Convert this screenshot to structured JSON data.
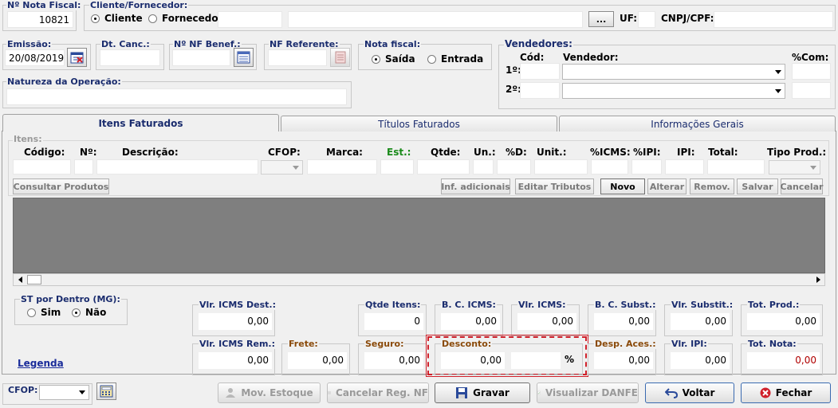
{
  "header": {
    "nota_fiscal_label": "Nº Nota Fiscal:",
    "nota_fiscal_value": "10821",
    "cliente_fornecedor_label": "Cliente/Fornecedor:",
    "radio_cliente": "Cliente",
    "radio_fornecedor": "Fornecedor",
    "ellipsis_label": "...",
    "uf_label": "UF:",
    "cnpj_label": "CNPJ/CPF:"
  },
  "dates": {
    "emissao_label": "Emissão:",
    "emissao_value": "20/08/2019",
    "dt_canc_label": "Dt. Canc.:",
    "nf_benef_label": "Nº NF Benef.:",
    "nf_referente_label": "NF Referente:",
    "nota_fiscal_group_label": "Nota fiscal:",
    "radio_saida": "Saída",
    "radio_entrada": "Entrada",
    "natureza_label": "Natureza da Operação:"
  },
  "vendedores": {
    "title": "Vendedores:",
    "cod_label": "Cód:",
    "vendedor_label": "Vendedor:",
    "com_label": "%Com:",
    "row1": "1º:",
    "row2": "2º:"
  },
  "tabs": [
    "Itens Faturados",
    "Títulos Faturados",
    "Informações Gerais"
  ],
  "itens": {
    "group_label": "Itens:",
    "col_codigo": "Código:",
    "col_no": "Nº:",
    "col_descricao": "Descrição:",
    "col_cfop": "CFOP:",
    "col_marca": "Marca:",
    "col_est": "Est.:",
    "col_qtde": "Qtde:",
    "col_un": "Un.:",
    "col_pd": "%D:",
    "col_unit": "Unit.:",
    "col_icms": "%ICMS:",
    "col_ipi_pct": "%IPI:",
    "col_ipi": "IPI:",
    "col_total": "Total:",
    "col_tipo_prod": "Tipo Prod.:",
    "btn_consultar": "Consultar Produtos",
    "btn_inf_adicionais": "Inf. adicionais",
    "btn_editar_tributos": "Editar Tributos",
    "btn_novo": "Novo",
    "btn_alterar": "Alterar",
    "btn_remover": "Remov.",
    "btn_salvar": "Salvar",
    "btn_cancelar": "Cancelar",
    "est_color": "#1a8a1a"
  },
  "st": {
    "label": "ST por Dentro (MG):",
    "radio_sim": "Sim",
    "radio_nao": "Não",
    "legenda": "Legenda"
  },
  "totals": {
    "vlr_icms_dest_label": "Vlr. ICMS Dest.:",
    "vlr_icms_dest": "0,00",
    "qtde_itens_label": "Qtde Itens:",
    "qtde_itens": "0",
    "bc_icms_label": "B. C. ICMS:",
    "bc_icms": "0,00",
    "vlr_icms_label": "Vlr. ICMS:",
    "vlr_icms": "0,00",
    "bc_subst_label": "B. C. Subst.:",
    "bc_subst": "0,00",
    "vlr_subst_label": "Vlr. Substit.:",
    "vlr_subst": "0,00",
    "tot_prod_label": "Tot. Prod.:",
    "tot_prod": "0,00",
    "vlr_icms_rem_label": "Vlr. ICMS Rem.:",
    "vlr_icms_rem": "0,00",
    "frete_label": "Frete:",
    "frete": "0,00",
    "seguro_label": "Seguro:",
    "seguro": "0,00",
    "desconto_label": "Desconto:",
    "desconto": "0,00",
    "desconto_pct_symbol": "%",
    "desp_aces_label": "Desp. Aces.:",
    "desp_aces": "0,00",
    "vlr_ipi_label": "Vlr. IPI:",
    "vlr_ipi": "0,00",
    "tot_nota_label": "Tot. Nota:",
    "tot_nota": "0,00",
    "brown_label_color": "#8a4a0a",
    "tot_nota_color": "#b00000",
    "highlight_color": "#d0202a"
  },
  "footer": {
    "cfop_label": "CFOP:",
    "btn_mov_estoque": "Mov. Estoque",
    "btn_cancelar_reg": "Cancelar Reg. NF",
    "btn_gravar": "Gravar",
    "btn_visualizar": "Visualizar DANFE",
    "btn_voltar": "Voltar",
    "btn_fechar": "Fechar"
  }
}
